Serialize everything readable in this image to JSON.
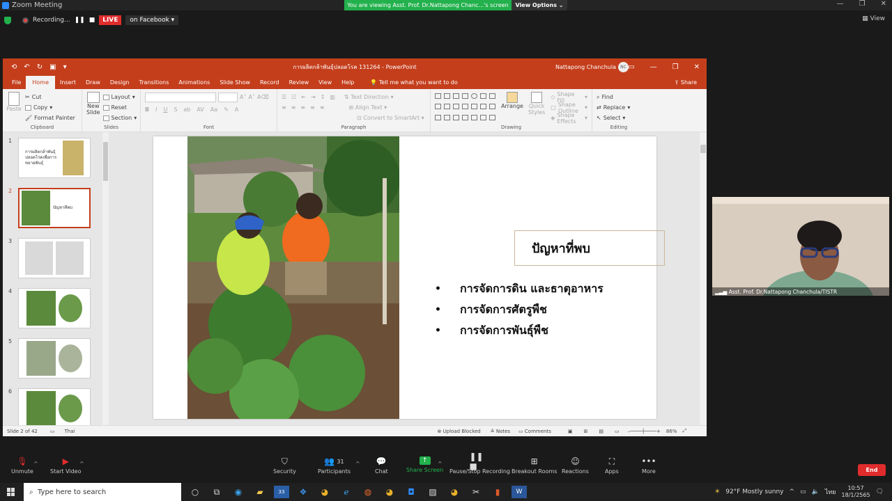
{
  "zoom": {
    "window_title": "Zoom Meeting",
    "viewing_banner": "You are viewing Asst. Prof. Dr.Nattapong Chanc...'s screen",
    "view_options": "View Options",
    "recording": "Recording...",
    "live": "LIVE",
    "live_target": "on Facebook",
    "view": "View",
    "camera_name": "Asst. Prof. Dr.Nattapong Chanchula/TISTR",
    "participants_count": "31",
    "toolbar": {
      "unmute": "Unmute",
      "start_video": "Start Video",
      "security": "Security",
      "participants": "Participants",
      "chat": "Chat",
      "share_screen": "Share Screen",
      "pause_recording": "Pause/Stop Recording",
      "breakout": "Breakout Rooms",
      "reactions": "Reactions",
      "apps": "Apps",
      "more": "More",
      "end": "End"
    }
  },
  "ppt": {
    "doc_title": "การผลิตกล้าพันธุ์ปลอดโรค 131264  -  PowerPoint",
    "user": "Nattapong Chanchula",
    "user_initials": "NC",
    "tabs": [
      "File",
      "Home",
      "Insert",
      "Draw",
      "Design",
      "Transitions",
      "Animations",
      "Slide Show",
      "Record",
      "Review",
      "View",
      "Help"
    ],
    "tell_me": "Tell me what you want to do",
    "share": "Share",
    "ribbon": {
      "paste": "Paste",
      "cut": "Cut",
      "copy": "Copy",
      "format_painter": "Format Painter",
      "clipboard": "Clipboard",
      "new_slide": "New Slide",
      "layout": "Layout",
      "reset": "Reset",
      "section": "Section",
      "slides": "Slides",
      "font": "Font",
      "text_direction": "Text Direction",
      "align_text": "Align Text",
      "convert_smartart": "Convert to SmartArt",
      "paragraph": "Paragraph",
      "arrange": "Arrange",
      "quick_styles": "Quick Styles",
      "shape_fill": "Shape Fill",
      "shape_outline": "Shape Outline",
      "shape_effects": "Shape Effects",
      "drawing": "Drawing",
      "find": "Find",
      "replace": "Replace",
      "select": "Select",
      "editing": "Editing"
    },
    "thumbnails": [
      {
        "num": "1",
        "text": "การผลิตกล้าพันธุ์ปลอดโรคเพื่อการขยายพันธุ์"
      },
      {
        "num": "2",
        "text": "ปัญหาที่พบ"
      },
      {
        "num": "3",
        "text": ""
      },
      {
        "num": "4",
        "text": ""
      },
      {
        "num": "5",
        "text": ""
      },
      {
        "num": "6",
        "text": ""
      }
    ],
    "slide": {
      "title": "ปัญหาที่พบ",
      "bullets": [
        "การจัดการดิน และธาตุอาหาร",
        "การจัดการศัตรูพืช",
        "การจัดการพันธุ์พืช"
      ]
    },
    "status": {
      "slide_of": "Slide 2 of 42",
      "language": "Thai",
      "upload": "Upload Blocked",
      "notes": "Notes",
      "comments": "Comments",
      "zoom": "86%"
    }
  },
  "taskbar": {
    "search": "Type here to search",
    "badge": "33",
    "weather": "92°F  Mostly sunny",
    "lang": "ไทย",
    "time": "10:57",
    "date": "18/1/2565"
  }
}
